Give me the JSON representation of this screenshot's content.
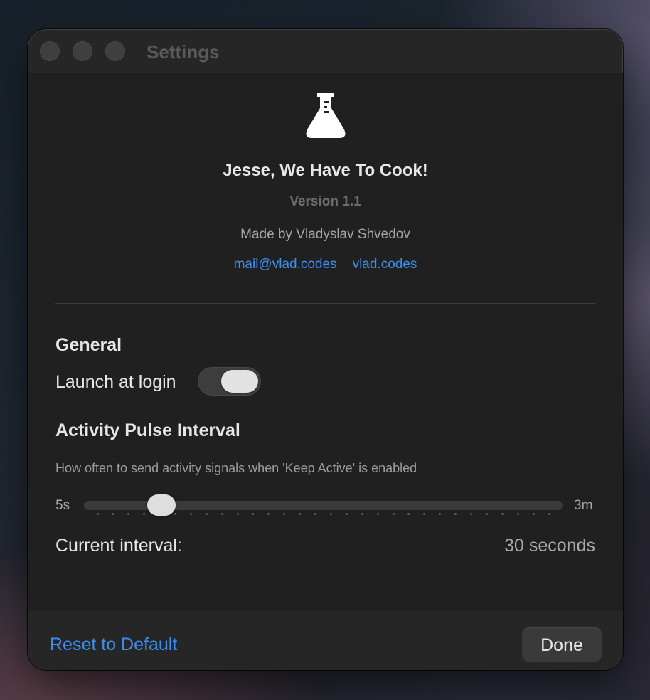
{
  "window": {
    "title": "Settings"
  },
  "about": {
    "icon": "flask-icon",
    "app_name": "Jesse, We Have To Cook!",
    "version": "Version 1.1",
    "author": "Made by Vladyslav Shvedov",
    "links": [
      {
        "label": "mail@vlad.codes"
      },
      {
        "label": "vlad.codes"
      }
    ]
  },
  "general": {
    "heading": "General",
    "launch_at_login": {
      "label": "Launch at login",
      "enabled": true
    }
  },
  "pulse": {
    "heading": "Activity Pulse Interval",
    "description": "How often to send activity signals when 'Keep Active' is enabled",
    "slider": {
      "min_label": "5s",
      "max_label": "3m",
      "tick_count": 30,
      "value_fraction": 0.142
    },
    "current_label": "Current interval:",
    "current_value": "30 seconds"
  },
  "footer": {
    "reset_label": "Reset to Default",
    "done_label": "Done"
  },
  "colors": {
    "accent": "#3b8ff0",
    "window_bg": "#202020",
    "toggle_on_knob": "#e2e2e2"
  }
}
